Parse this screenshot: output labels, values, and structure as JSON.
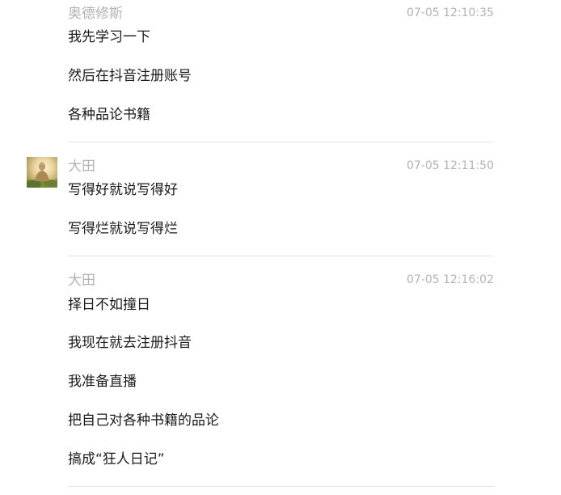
{
  "messages": [
    {
      "sender": "奥德修斯",
      "time": "07-05 12:10:35",
      "has_avatar": false,
      "lines": [
        "我先学习一下",
        "然后在抖音注册账号",
        "各种品论书籍"
      ]
    },
    {
      "sender": "大田",
      "time": "07-05 12:11:50",
      "has_avatar": true,
      "avatar_icon": "buddha-statue-avatar",
      "lines": [
        "写得好就说写得好",
        "写得烂就说写得烂"
      ]
    },
    {
      "sender": "大田",
      "time": "07-05 12:16:02",
      "has_avatar": false,
      "lines": [
        "择日不如撞日",
        "我现在就去注册抖音",
        "我准备直播",
        "把自己对各种书籍的品论",
        "搞成“狂人日记”"
      ]
    }
  ]
}
